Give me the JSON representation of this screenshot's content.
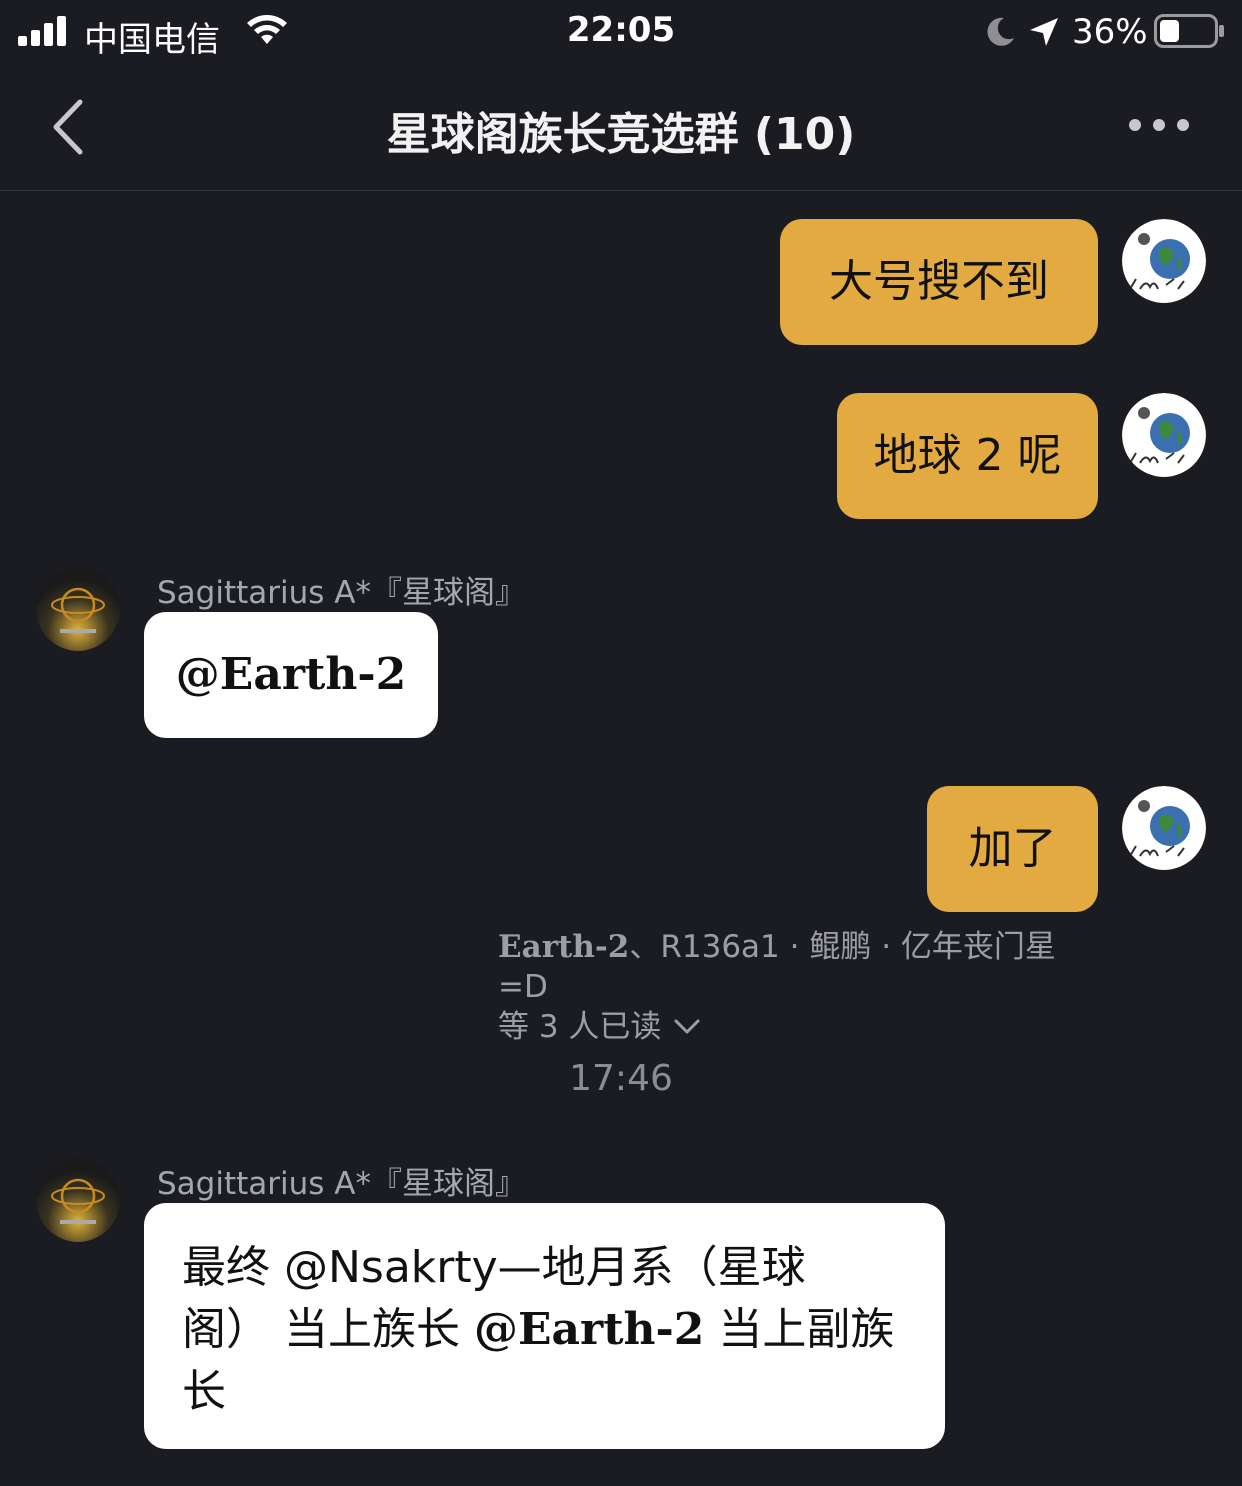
{
  "status_bar": {
    "carrier": "中国电信",
    "time": "22:05",
    "battery_percent": "36%",
    "battery_level": 0.36
  },
  "nav": {
    "title": "星球阁族长竞选群 (10)"
  },
  "messages": [
    {
      "text": "大号搜不到"
    },
    {
      "text": "地球 2 呢"
    },
    {
      "sender": "Sagittarius A*『星球阁』",
      "text": "@Earth-2"
    },
    {
      "text": "加了"
    },
    {
      "read_receipt": {
        "line1_prefix": "Earth-2",
        "line1_rest": "、R136a1 · 鲲鹏 · 亿年丧门星=D",
        "line2": "等 3 人已读"
      }
    },
    {
      "timestamp": "17:46"
    },
    {
      "sender": "Sagittarius A*『星球阁』",
      "line1": "最终 @Nsakrty—地月系（星球",
      "line2_a": "阁） 当上族长 ",
      "line2_mention": "@Earth-2",
      "line2_b": " 当上副族",
      "line3": "长"
    }
  ],
  "colors": {
    "background": "#1b1b22",
    "outgoing_bubble": "#e3aa42",
    "incoming_bubble": "#ffffff",
    "muted_text": "#a6a6ad"
  }
}
